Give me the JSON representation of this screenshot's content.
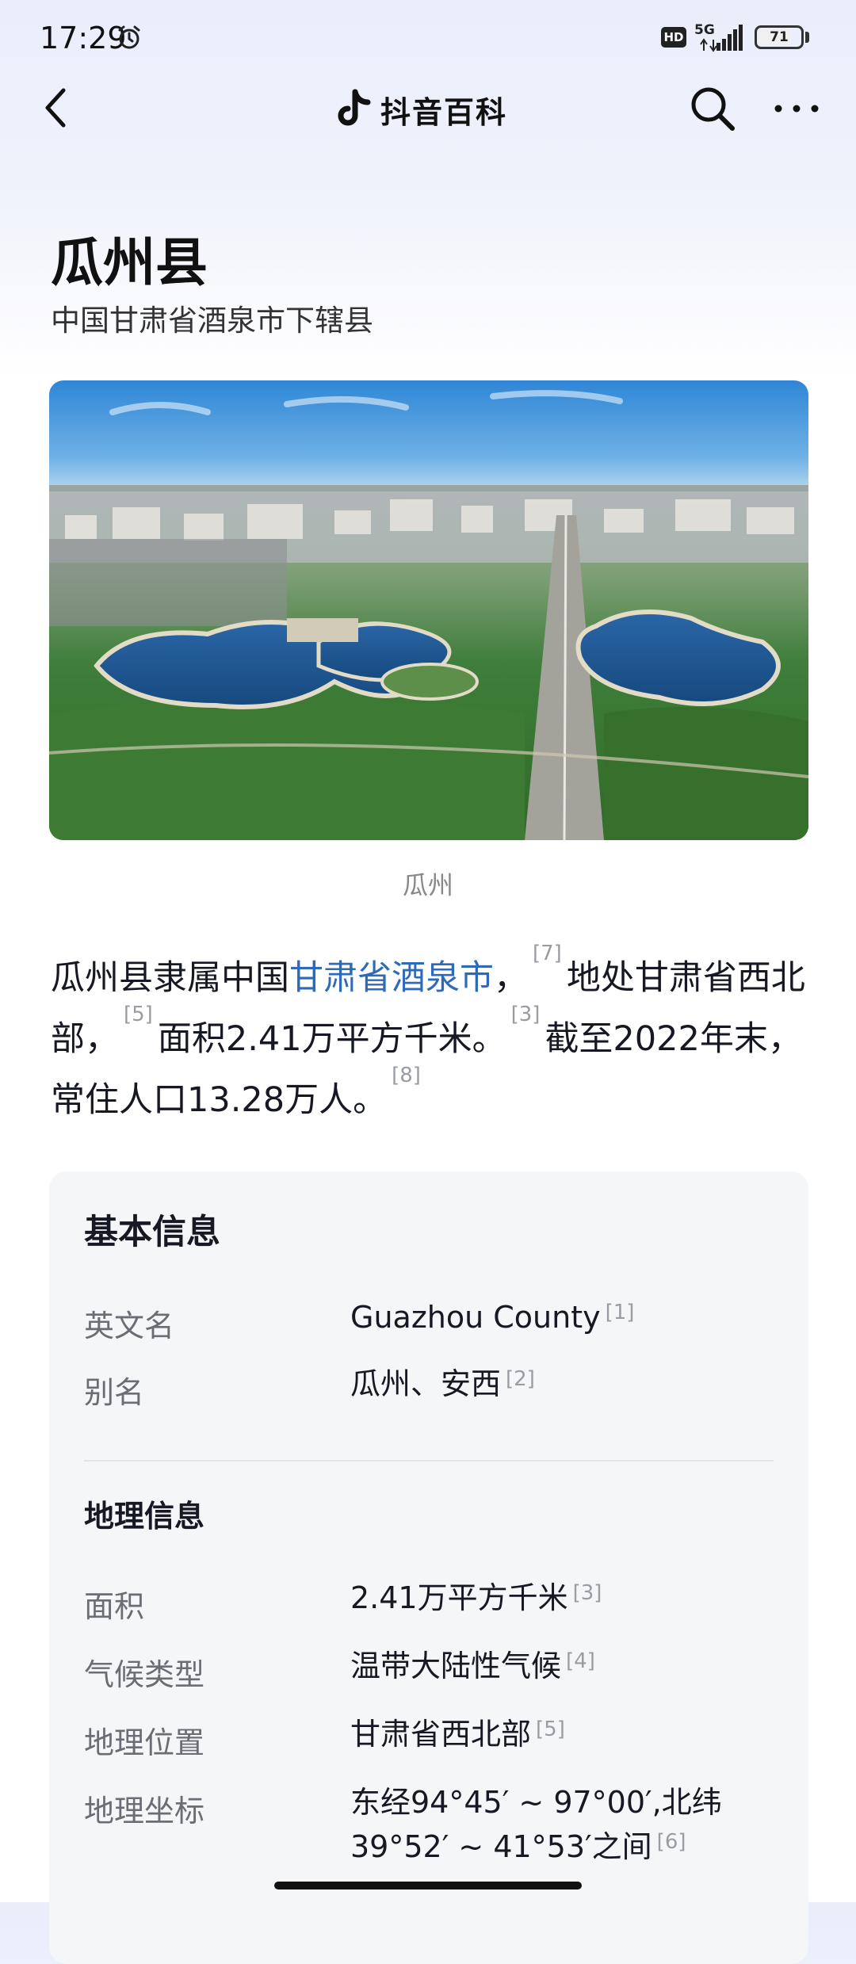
{
  "status_bar": {
    "time": "17:29",
    "network": "5G",
    "hd_badge": "HD",
    "battery": "71",
    "icons": [
      "alarm-icon",
      "signal-icon",
      "battery-icon"
    ]
  },
  "nav": {
    "brand": "抖音百科",
    "icons": [
      "back-icon",
      "tiktok-logo-icon",
      "search-icon",
      "more-icon"
    ]
  },
  "entry": {
    "title": "瓜州县",
    "subtitle": "中国甘肃省酒泉市下辖县",
    "image_caption": "瓜州"
  },
  "intro": {
    "t1": "瓜州县隶属中国",
    "link": "甘肃省酒泉市",
    "t2": "，",
    "ref1": "[7]",
    "t3": "地处甘肃省西北部，",
    "ref2": "[5]",
    "t4": "面积2.41万平方千米。",
    "ref3": "[3]",
    "t5": "截至2022年末，常住人口13.28万人。",
    "ref4": "[8]"
  },
  "basic_info": {
    "title": "基本信息",
    "rows": [
      {
        "label": "英文名",
        "value": "Guazhou County",
        "ref": "[1]"
      },
      {
        "label": "别名",
        "value": "瓜州、安西",
        "ref": "[2]"
      }
    ]
  },
  "geo_info": {
    "title": "地理信息",
    "rows": [
      {
        "label": "面积",
        "value": "2.41万平方千米",
        "ref": "[3]"
      },
      {
        "label": "气候类型",
        "value": "温带大陆性气候",
        "ref": "[4]"
      },
      {
        "label": "地理位置",
        "value": "甘肃省西北部",
        "ref": "[5]"
      },
      {
        "label": "地理坐标",
        "value_line1": "东经94°45′ ~ 97°00′,北纬",
        "value_line2": "39°52′ ~ 41°53′之间",
        "ref": "[6]"
      }
    ]
  }
}
